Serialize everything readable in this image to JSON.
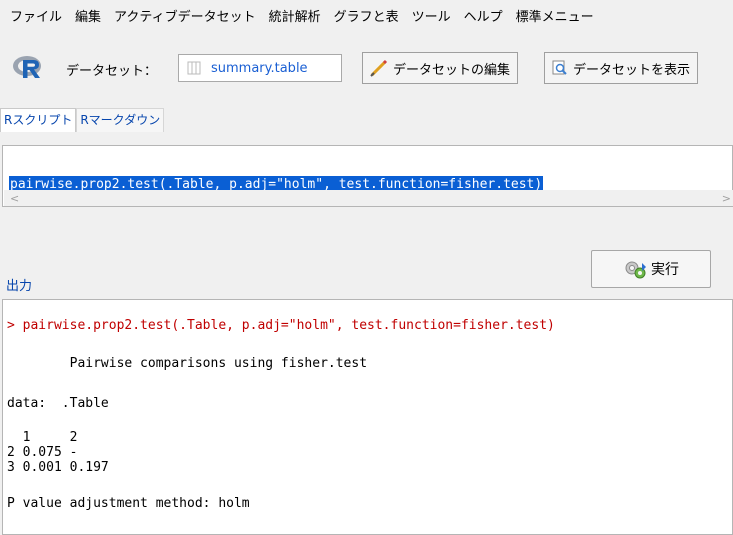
{
  "menu": {
    "items": [
      "ファイル",
      "編集",
      "アクティブデータセット",
      "統計解析",
      "グラフと表",
      "ツール",
      "ヘルプ",
      "標準メニュー"
    ]
  },
  "toolbar": {
    "dataset_label": "データセット：",
    "dataset_name": "summary.table",
    "edit_button": "データセットの編集",
    "view_button": "データセットを表示"
  },
  "tabs": [
    "Rスクリプト",
    "Rマークダウン"
  ],
  "script": {
    "line": "pairwise.prop2.test(.Table, p.adj=\"holm\", test.function=fisher.test)"
  },
  "run_button": "実行",
  "output": {
    "label": "出力",
    "lines": [
      "> pairwise.prop2.test(.Table, p.adj=\"holm\", test.function=fisher.test)",
      "        Pairwise comparisons using fisher.test",
      "data:  .Table",
      "  1     2",
      "2 0.075 -",
      "3 0.001 0.197",
      "P value adjustment method: holm"
    ]
  },
  "colors": {
    "selection": "#0a5fd4",
    "link_blue": "#0645ad",
    "command_red": "#c00000"
  }
}
